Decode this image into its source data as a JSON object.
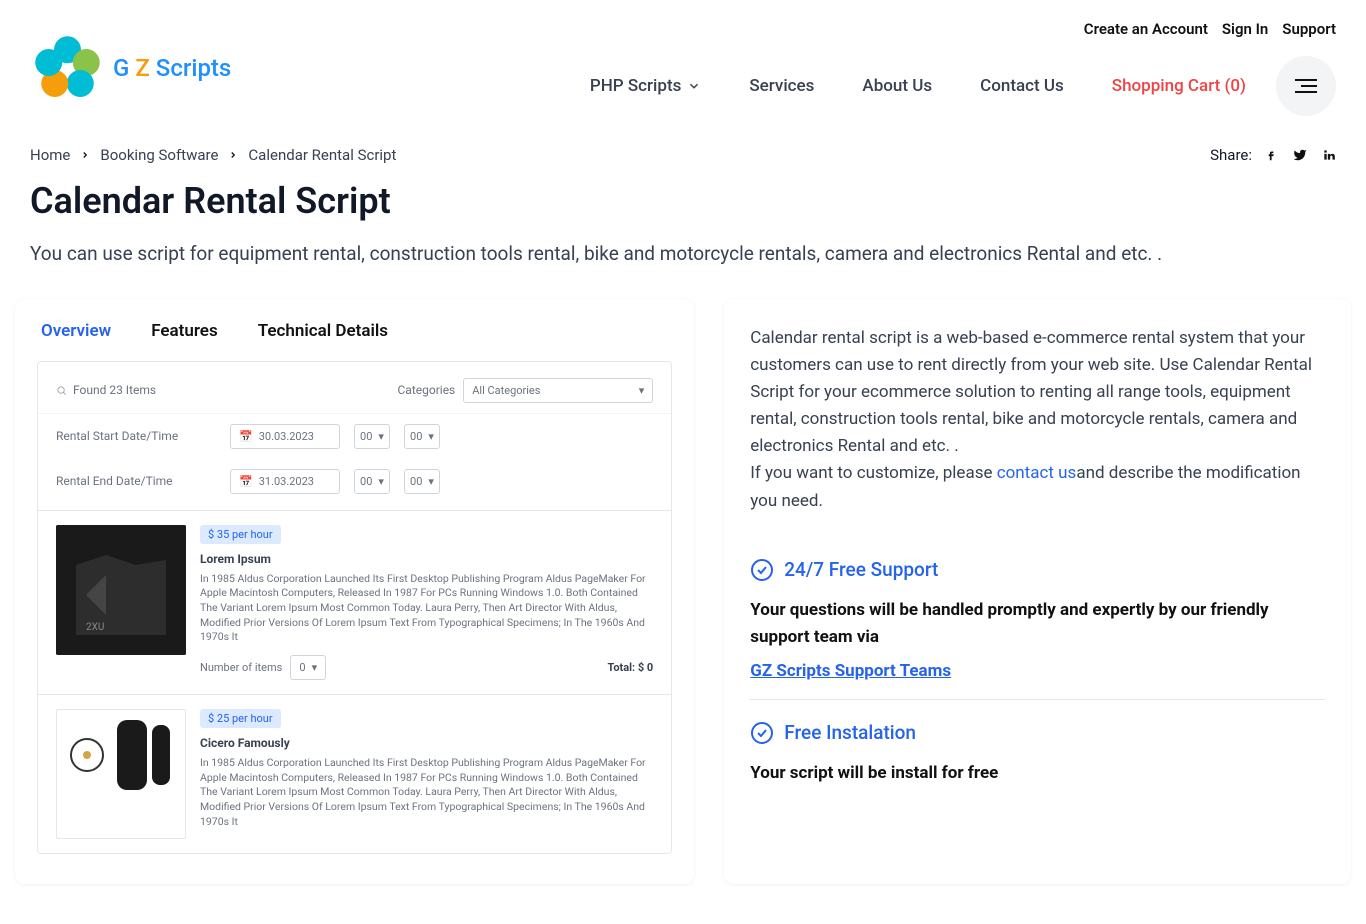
{
  "brand": {
    "g": "G",
    "z": "Z",
    "s": "Scripts"
  },
  "top_links": {
    "create": "Create an Account",
    "signin": "Sign In",
    "support": "Support"
  },
  "nav": {
    "php": "PHP Scripts",
    "services": "Services",
    "about": "About Us",
    "contact": "Contact Us",
    "cart": "Shopping Cart (0)"
  },
  "breadcrumb": {
    "home": "Home",
    "cat": "Booking Software",
    "page": "Calendar Rental Script"
  },
  "share_label": "Share:",
  "page_title": "Calendar Rental Script",
  "page_sub": "You can use script for equipment rental, construction tools rental, bike and motorcycle rentals, camera and electronics Rental and etc. .",
  "tabs": {
    "overview": "Overview",
    "features": "Features",
    "tech": "Technical Details"
  },
  "preview": {
    "found": "Found 23 Items",
    "cat_label": "Categories",
    "cat_value": "All Categories",
    "start_label": "Rental Start Date/Time",
    "start_date": "30.03.2023",
    "end_label": "Rental End Date/Time",
    "end_date": "31.03.2023",
    "hh": "00",
    "mm": "00",
    "item1": {
      "badge": "$ 35 per hour",
      "title": "Lorem Ipsum",
      "desc": "In 1985 Aldus Corporation Launched Its First Desktop Publishing Program Aldus PageMaker For Apple Macintosh Computers, Released In 1987 For PCs Running Windows 1.0. Both Contained The Variant Lorem Ipsum Most Common Today. Laura Perry, Then Art Director With Aldus, Modified Prior Versions Of Lorem Ipsum Text From Typographical Specimens; In The 1960s And 1970s It",
      "num_label": "Number of items",
      "num_value": "0",
      "total": "Total: $ 0"
    },
    "item2": {
      "badge": "$ 25 per hour",
      "title": "Cicero Famously",
      "desc": "In 1985 Aldus Corporation Launched Its First Desktop Publishing Program Aldus PageMaker For Apple Macintosh Computers, Released In 1987 For PCs Running Windows 1.0. Both Contained The Variant Lorem Ipsum Most Common Today. Laura Perry, Then Art Director With Aldus, Modified Prior Versions Of Lorem Ipsum Text From Typographical Specimens; In The 1960s And 1970s It"
    }
  },
  "sidebar": {
    "desc": "Calendar rental script is a web-based e-commerce rental system that your customers can use to rent directly from your web site. Use Calendar Rental Script for your ecommerce solution to renting all range tools, equipment rental, construction tools rental, bike and motorcycle rentals, camera and electronics Rental and etc. .",
    "customize_prefix": "If you want to customize, please ",
    "contact": "contact us",
    "customize_suffix": "and describe the modification you need.",
    "feat1_title": "24/7 Free Support",
    "feat1_body": "Your questions will be handled promptly and expertly by our friendly support team via",
    "feat1_link": "GZ Scripts Support Teams",
    "feat2_title": "Free Instalation",
    "feat2_body": "Your script will be install for free"
  }
}
